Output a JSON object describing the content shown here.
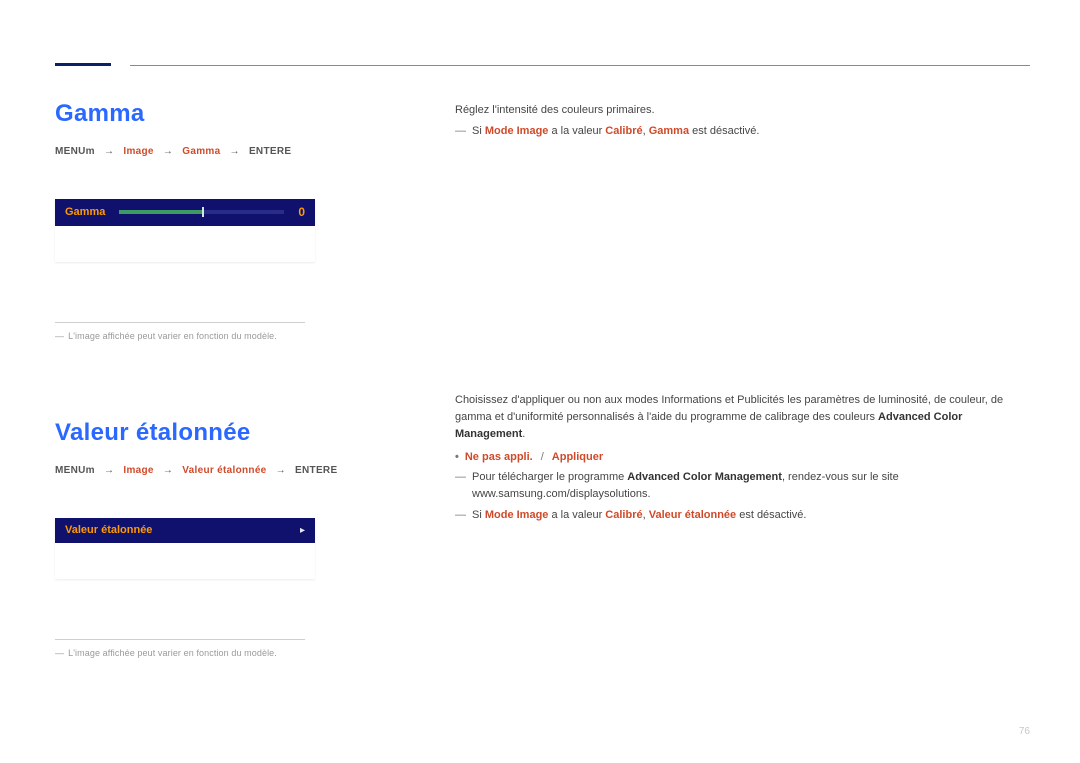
{
  "page": {
    "number": "76"
  },
  "gamma": {
    "title": "Gamma",
    "breadcrumb": {
      "a": "MENU",
      "m": "m",
      "b": "Image",
      "c": "Gamma",
      "d": "ENTER",
      "e": "E"
    },
    "panel": {
      "label": "Gamma",
      "value": "0"
    },
    "note": "L'image affichée peut varier en fonction du modèle.",
    "desc": "Réglez l'intensité des couleurs primaires.",
    "warn": {
      "pre": "Si ",
      "a": "Mode Image",
      "mid": " a la valeur ",
      "b": "Calibré",
      "sep": ", ",
      "c": "Gamma",
      "post": " est désactivé."
    }
  },
  "calibrated": {
    "title": "Valeur étalonnée",
    "breadcrumb": {
      "a": "MENU",
      "m": "m",
      "b": "Image",
      "c": "Valeur étalonnée",
      "d": "ENTER",
      "e": "E"
    },
    "panel": {
      "label": "Valeur étalonnée"
    },
    "note": "L'image affichée peut varier en fonction du modèle.",
    "desc1": "Choisissez d'appliquer ou non aux modes Informations et Publicités les paramètres de luminosité, de couleur, de gamma et d'uniformité personnalisés à l'aide du programme de calibrage des couleurs ",
    "desc1b": "Advanced Color Management",
    "desc1c": ".",
    "options": {
      "a": "Ne pas appli.",
      "b": "Appliquer"
    },
    "dl": {
      "pre": "Pour télécharger le programme ",
      "prog": "Advanced Color Management",
      "post": ", rendez-vous sur le site www.samsung.com/displaysolutions."
    },
    "warn": {
      "pre": "Si ",
      "a": "Mode Image",
      "mid": " a la valeur ",
      "b": "Calibré",
      "sep": ", ",
      "c": "Valeur étalonnée",
      "post": " est désactivé."
    }
  }
}
